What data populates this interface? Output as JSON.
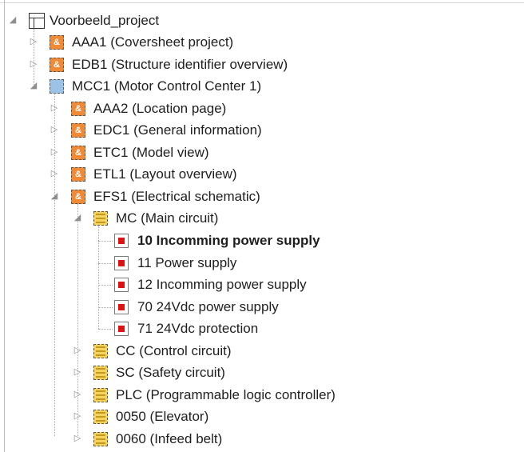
{
  "tree": {
    "root": {
      "label": "Voorbeeld_project"
    },
    "nodes": [
      {
        "label": "AAA1 (Coversheet project)",
        "icon": "orange-structure-icon"
      },
      {
        "label": "EDB1 (Structure identifier overview)",
        "icon": "orange-structure-icon"
      },
      {
        "label": "MCC1 (Motor Control Center 1)",
        "icon": "blue-location-icon"
      },
      {
        "label": "AAA2 (Location page)",
        "icon": "orange-structure-icon"
      },
      {
        "label": "EDC1 (General information)",
        "icon": "orange-structure-icon"
      },
      {
        "label": "ETC1 (Model view)",
        "icon": "orange-structure-icon"
      },
      {
        "label": "ETL1 (Layout overview)",
        "icon": "orange-structure-icon"
      },
      {
        "label": "EFS1 (Electrical schematic)",
        "icon": "orange-structure-icon"
      },
      {
        "label": "MC (Main circuit)",
        "icon": "yellow-function-icon"
      },
      {
        "label": "10 Incomming power supply",
        "icon": "page-icon"
      },
      {
        "label": "11 Power supply",
        "icon": "page-icon"
      },
      {
        "label": "12 Incomming power supply",
        "icon": "page-icon"
      },
      {
        "label": "70 24Vdc power supply",
        "icon": "page-icon"
      },
      {
        "label": "71 24Vdc protection",
        "icon": "page-icon"
      },
      {
        "label": "CC (Control circuit)",
        "icon": "yellow-function-icon"
      },
      {
        "label": "SC (Safety circuit)",
        "icon": "yellow-function-icon"
      },
      {
        "label": "PLC (Programmable logic controller)",
        "icon": "yellow-function-icon"
      },
      {
        "label": "0050 (Elevator)",
        "icon": "yellow-function-icon"
      },
      {
        "label": "0060 (Infeed belt)",
        "icon": "yellow-function-icon"
      }
    ]
  },
  "colors": {
    "orange": "#f08a37",
    "blue": "#9cc3e6",
    "yellow": "#f6d25e",
    "page_red": "#dd1111",
    "selected_text": "#1e1e1e"
  }
}
